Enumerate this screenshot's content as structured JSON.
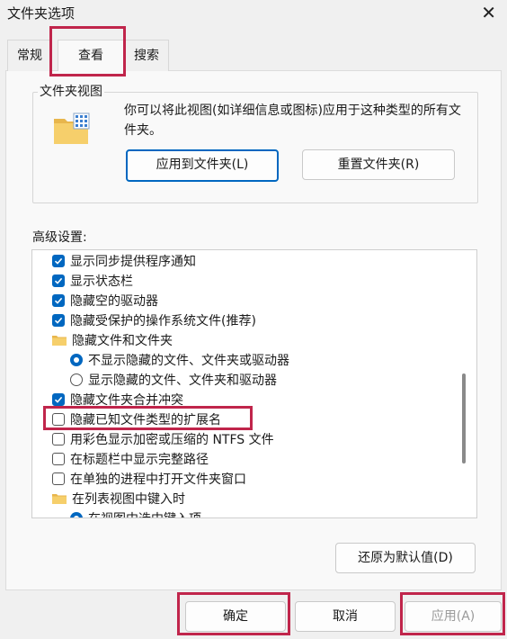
{
  "window": {
    "title": "文件夹选项",
    "close_glyph": "✕"
  },
  "tabs": [
    {
      "label": "常规"
    },
    {
      "label": "查看"
    },
    {
      "label": "搜索"
    }
  ],
  "folder_views": {
    "group_title": "文件夹视图",
    "description": "你可以将此视图(如详细信息或图标)应用于这种类型的所有文件夹。",
    "apply_button": "应用到文件夹(L)",
    "reset_button": "重置文件夹(R)"
  },
  "advanced": {
    "label": "高级设置:",
    "items": [
      {
        "type": "checkbox",
        "checked": true,
        "label": "显示同步提供程序通知"
      },
      {
        "type": "checkbox",
        "checked": true,
        "label": "显示状态栏"
      },
      {
        "type": "checkbox",
        "checked": true,
        "label": "隐藏空的驱动器"
      },
      {
        "type": "checkbox",
        "checked": true,
        "label": "隐藏受保护的操作系统文件(推荐)"
      },
      {
        "type": "folder",
        "label": "隐藏文件和文件夹"
      },
      {
        "type": "radio",
        "checked": true,
        "label": "不显示隐藏的文件、文件夹或驱动器"
      },
      {
        "type": "radio",
        "checked": false,
        "label": "显示隐藏的文件、文件夹和驱动器"
      },
      {
        "type": "checkbox",
        "checked": true,
        "label": "隐藏文件夹合并冲突"
      },
      {
        "type": "checkbox",
        "checked": false,
        "label": "隐藏已知文件类型的扩展名"
      },
      {
        "type": "checkbox",
        "checked": false,
        "label": "用彩色显示加密或压缩的 NTFS 文件"
      },
      {
        "type": "checkbox",
        "checked": false,
        "label": "在标题栏中显示完整路径"
      },
      {
        "type": "checkbox",
        "checked": false,
        "label": "在单独的进程中打开文件夹窗口"
      },
      {
        "type": "folder",
        "label": "在列表视图中键入时"
      },
      {
        "type": "radio",
        "checked": true,
        "label": "在视图中选中键入项"
      }
    ]
  },
  "buttons": {
    "restore_defaults": "还原为默认值(D)",
    "ok": "确定",
    "cancel": "取消",
    "apply": "应用(A)"
  },
  "colors": {
    "accent": "#0067c0",
    "highlight": "#c0254b"
  }
}
